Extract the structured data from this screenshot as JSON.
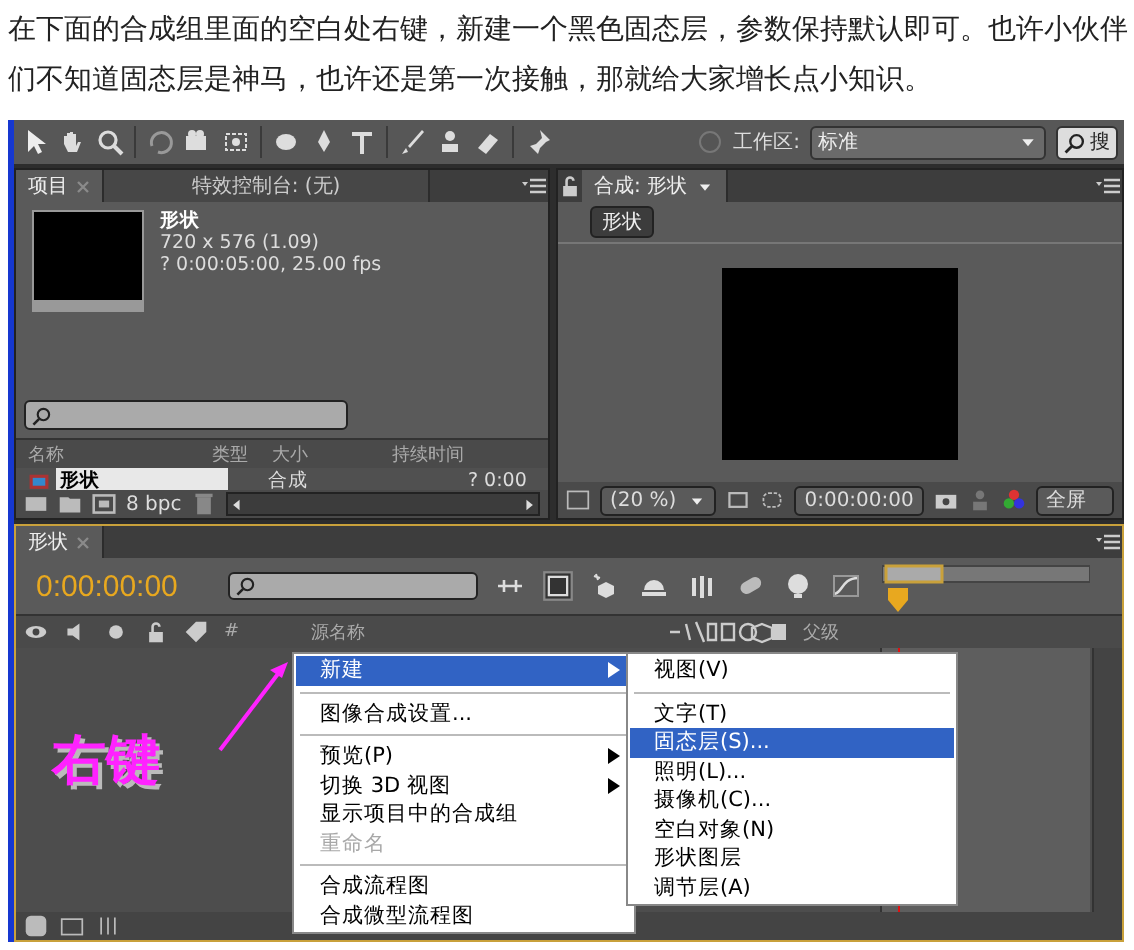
{
  "article": {
    "paragraph": "在下面的合成组里面的空白处右键，新建一个黑色固态层，参数保持默认即可。也许小伙伴们不知道固态层是神马，也许还是第一次接触，那就给大家增长点小知识。"
  },
  "toolbar": {
    "workspace_label": "工作区:",
    "workspace_value": "标准",
    "search_label": "搜"
  },
  "project_panel": {
    "tabs": [
      {
        "label": "项目",
        "selected": true
      },
      {
        "label": "特效控制台: (无)",
        "selected": false
      }
    ],
    "item_name": "形状",
    "dimensions": "720 x 576 (1.09)",
    "duration_info": "? 0:00:05:00, 25.00 fps",
    "columns": [
      "名称",
      "类型",
      "大小",
      "持续时间"
    ],
    "rows": [
      {
        "name": "形状",
        "type": "合成",
        "duration": "? 0:00",
        "selected": true
      }
    ],
    "bit_depth": "8 bpc"
  },
  "composition_panel": {
    "tab": "合成: 形状",
    "breadcrumb": "形状",
    "zoom": "(20 %)",
    "timecode": "0:00:00:00",
    "resolution": "全屏"
  },
  "timeline": {
    "tab": "形状",
    "timecode": "0:00:00:00",
    "columns": [
      "#",
      "源名称",
      "父级"
    ]
  },
  "annotation": {
    "text": "右键"
  },
  "context_menu": {
    "items": [
      {
        "kind": "item",
        "label": "新建",
        "submenu": true,
        "selected": true,
        "disabled": false
      },
      {
        "kind": "separator"
      },
      {
        "kind": "item",
        "label": "图像合成设置...",
        "submenu": false,
        "selected": false,
        "disabled": false
      },
      {
        "kind": "separator"
      },
      {
        "kind": "item",
        "label": "预览(P)",
        "submenu": true,
        "selected": false,
        "disabled": false
      },
      {
        "kind": "item",
        "label": "切换 3D 视图",
        "submenu": true,
        "selected": false,
        "disabled": false
      },
      {
        "kind": "item",
        "label": "显示项目中的合成组",
        "submenu": false,
        "selected": false,
        "disabled": false
      },
      {
        "kind": "item",
        "label": "重命名",
        "submenu": false,
        "selected": false,
        "disabled": true
      },
      {
        "kind": "separator"
      },
      {
        "kind": "item",
        "label": "合成流程图",
        "submenu": false,
        "selected": false,
        "disabled": false
      },
      {
        "kind": "item",
        "label": "合成微型流程图",
        "submenu": false,
        "selected": false,
        "disabled": false
      }
    ]
  },
  "submenu": {
    "items": [
      {
        "kind": "item",
        "label": "视图(V)",
        "selected": false
      },
      {
        "kind": "separator"
      },
      {
        "kind": "item",
        "label": "文字(T)",
        "selected": false
      },
      {
        "kind": "item",
        "label": "固态层(S)...",
        "selected": true
      },
      {
        "kind": "item",
        "label": "照明(L)...",
        "selected": false
      },
      {
        "kind": "item",
        "label": "摄像机(C)...",
        "selected": false
      },
      {
        "kind": "item",
        "label": "空白对象(N)",
        "selected": false
      },
      {
        "kind": "item",
        "label": "形状图层",
        "selected": false
      },
      {
        "kind": "item",
        "label": "调节层(A)",
        "selected": false
      }
    ]
  }
}
